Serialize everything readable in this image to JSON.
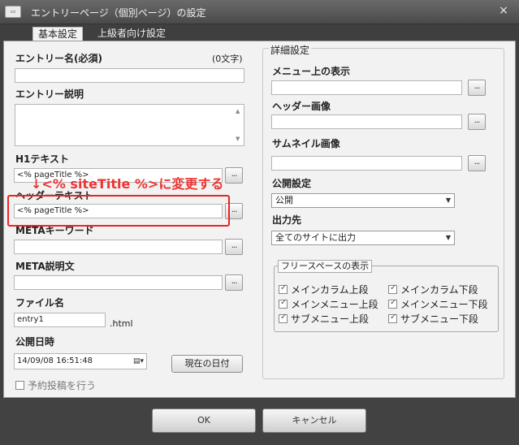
{
  "window": {
    "app_icon": "app-icon",
    "title": "エントリーページ（個別ページ）の設定",
    "close": "×"
  },
  "tabs": [
    {
      "label": "基本設定",
      "active": true
    },
    {
      "label": "上級者向け設定",
      "active": false
    }
  ],
  "left": {
    "entry_name": {
      "label": "エントリー名(必須)",
      "counter": "(0文字)",
      "value": ""
    },
    "entry_desc": {
      "label": "エントリー説明",
      "value": ""
    },
    "h1": {
      "label": "H1テキスト",
      "value": "<% pageTitle %>",
      "button": "..."
    },
    "header_text": {
      "label": "ヘッダーテキスト",
      "value": "<% pageTitle %>",
      "button": "..."
    },
    "meta_keyword": {
      "label": "METAキーワード",
      "value": "",
      "button": "..."
    },
    "meta_desc": {
      "label": "META説明文",
      "value": "",
      "button": "..."
    },
    "file_name": {
      "label": "ファイル名",
      "value": "entry1",
      "ext": ".html"
    },
    "publish_date": {
      "label": "公開日時",
      "value": "14/09/08 16:51:48",
      "today_button": "現在の日付"
    },
    "scheduled": {
      "label": "予約投稿を行う",
      "checked": false
    }
  },
  "right": {
    "section_title": "詳細設定",
    "menu_display": {
      "label": "メニュー上の表示",
      "value": "",
      "button": "..."
    },
    "header_image": {
      "label": "ヘッダー画像",
      "value": "",
      "button": "..."
    },
    "thumbnail": {
      "label": "サムネイル画像",
      "value": "",
      "button": "..."
    },
    "publish_setting": {
      "label": "公開設定",
      "selected": "公開"
    },
    "output": {
      "label": "出力先",
      "selected": "全てのサイトに出力"
    },
    "free_space": {
      "legend": "フリースペースの表示",
      "items": [
        {
          "label": "メインカラム上段",
          "checked": true
        },
        {
          "label": "メインカラム下段",
          "checked": true
        },
        {
          "label": "メインメニュー上段",
          "checked": true
        },
        {
          "label": "メインメニュー下段",
          "checked": true
        },
        {
          "label": "サブメニュー上段",
          "checked": true
        },
        {
          "label": "サブメニュー下段",
          "checked": true
        }
      ]
    }
  },
  "annotation": {
    "text": "↓<% siteTitle %>に変更する",
    "color": "#e33333"
  },
  "footer": {
    "ok": "OK",
    "cancel": "キャンセル"
  },
  "colors": {
    "window_bg": "#3f3f3f",
    "panel_bg": "#f2f2f2",
    "accent_red": "#e22222"
  }
}
